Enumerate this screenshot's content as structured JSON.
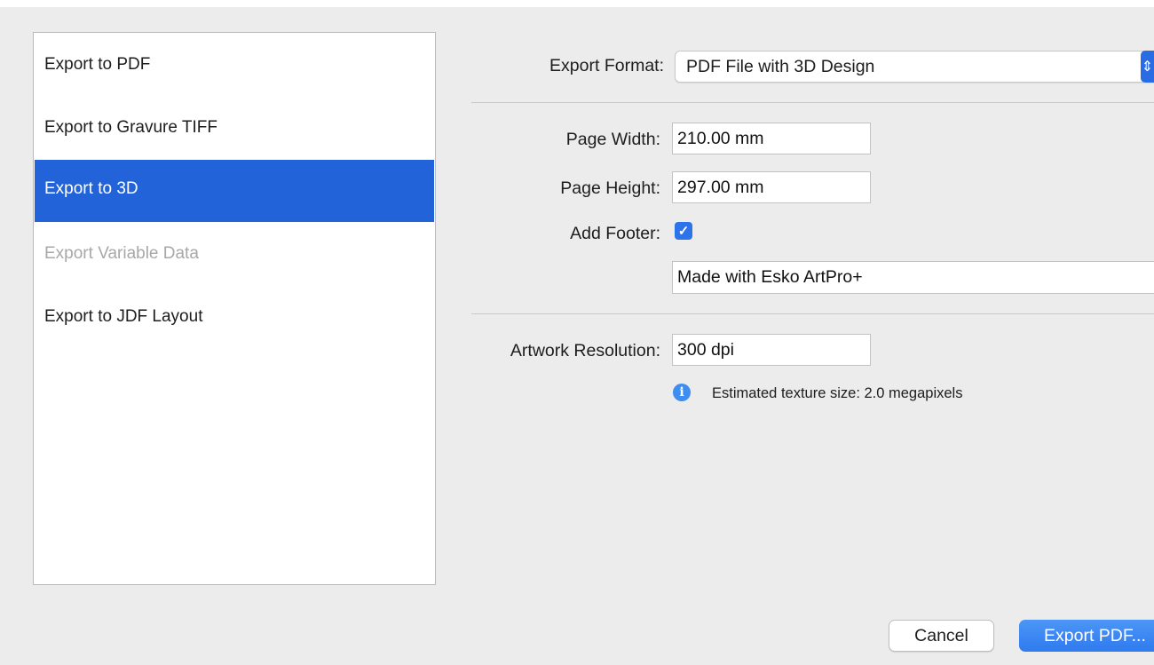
{
  "export_list": {
    "items": [
      {
        "label": "Export to PDF",
        "state": "normal"
      },
      {
        "label": "Export to Gravure TIFF",
        "state": "normal"
      },
      {
        "label": "Export to 3D",
        "state": "selected"
      },
      {
        "label": "Export Variable Data",
        "state": "disabled"
      },
      {
        "label": "Export to JDF Layout",
        "state": "normal"
      }
    ]
  },
  "form": {
    "export_format_label": "Export Format:",
    "export_format_value": "PDF File with 3D Design",
    "page_width_label": "Page Width:",
    "page_width_value": "210.00 mm",
    "page_height_label": "Page Height:",
    "page_height_value": "297.00 mm",
    "add_footer_label": "Add Footer:",
    "add_footer_checked": true,
    "footer_text_value": "Made with Esko ArtPro+",
    "artwork_resolution_label": "Artwork Resolution:",
    "artwork_resolution_value": "300 dpi",
    "texture_info": "Estimated texture size: 2.0 megapixels"
  },
  "buttons": {
    "cancel_label": "Cancel",
    "export_label": "Export PDF..."
  },
  "icons": {
    "checkbox": "checkmark-icon",
    "info": "info-icon",
    "select": "chevron-updown-icon"
  },
  "colors": {
    "selection": "#2263d9",
    "accent": "#2d73ea",
    "disabled_text": "#a8a8a8",
    "background": "#ececec"
  }
}
